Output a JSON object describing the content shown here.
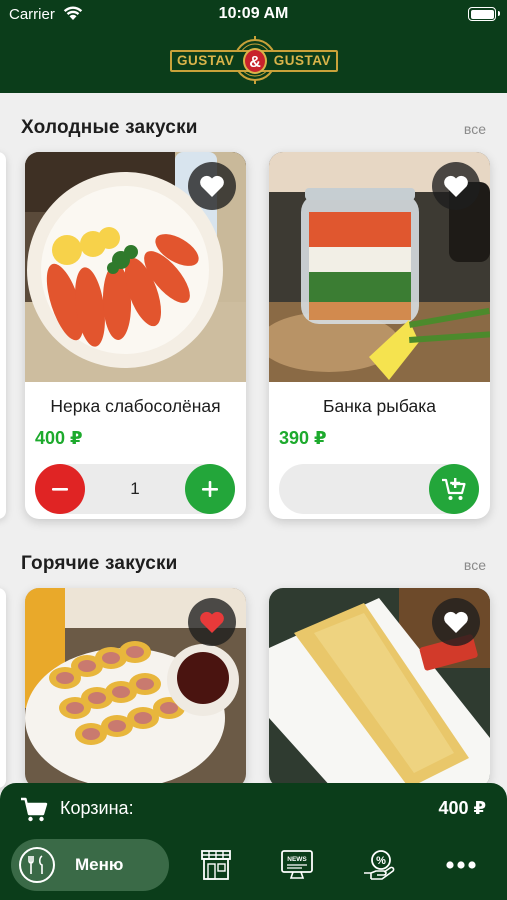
{
  "status_bar": {
    "carrier": "Carrier",
    "time": "10:09 AM"
  },
  "header": {
    "logo_left": "GUSTAV",
    "logo_amp": "&",
    "logo_right": "GUSTAV",
    "logo_ring_text": "РЕСТОРАН ПИВОВАРНЯ"
  },
  "colors": {
    "brand_green": "#0b3d1a",
    "price_green": "#1daa2d",
    "minus_red": "#e02424",
    "plus_green": "#23a63a",
    "fav_active": "#e83a3a"
  },
  "sections": [
    {
      "title": "Холодные закуски",
      "see_all": "все",
      "items": [
        {
          "name": "Нерка слабосолёная",
          "price": "400 ₽",
          "quantity": "1",
          "favorite": false,
          "in_cart": true
        },
        {
          "name": "Банка рыбака",
          "price": "390 ₽",
          "favorite": false,
          "in_cart": false
        }
      ]
    },
    {
      "title": "Горячие закуски",
      "see_all": "все",
      "items": [
        {
          "favorite": true
        },
        {
          "favorite": false
        }
      ]
    }
  ],
  "cart_bar": {
    "label": "Корзина:",
    "total": "400 ₽"
  },
  "tabbar": {
    "active_label": "Меню",
    "icons": [
      "menu-icon",
      "restaurant-icon",
      "news-icon",
      "discount-icon",
      "more-icon"
    ]
  }
}
